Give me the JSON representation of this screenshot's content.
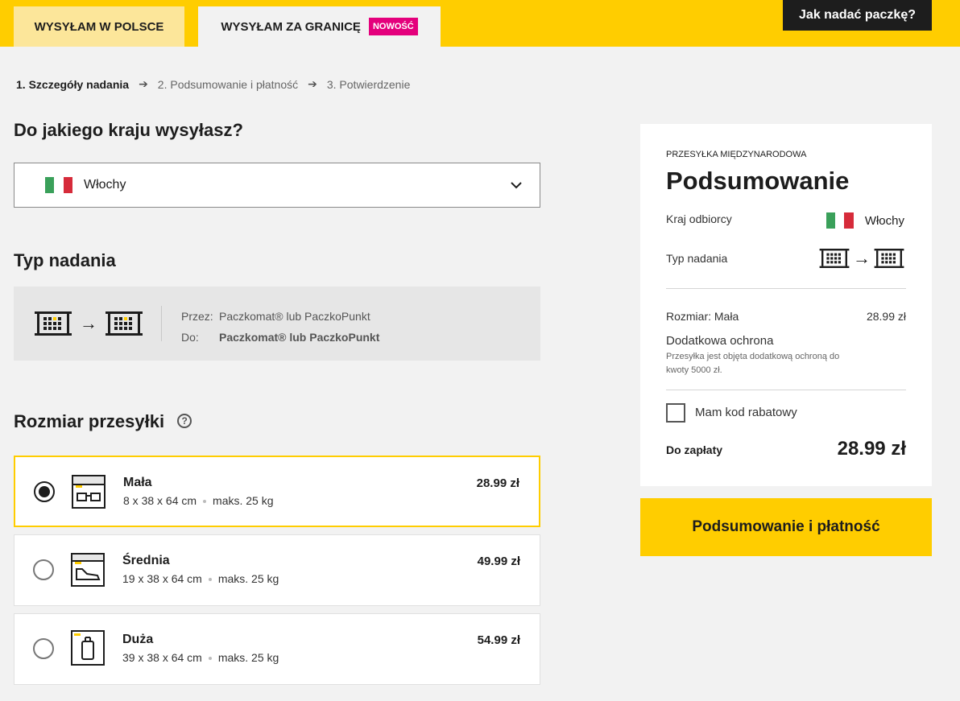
{
  "header": {
    "tab_domestic": "WYSYŁAM W POLSCE",
    "tab_abroad": "WYSYŁAM ZA GRANICĘ",
    "badge_new": "NOWOŚĆ",
    "how_to_button": "Jak nadać paczkę?",
    "accent_color": "#ffcd00"
  },
  "steps": [
    {
      "label": "1. Szczegóły nadania",
      "active": true
    },
    {
      "label": "2. Podsumowanie i płatność",
      "active": false
    },
    {
      "label": "3. Potwierdzenie",
      "active": false
    }
  ],
  "country_section": {
    "heading": "Do jakiego kraju wysyłasz?",
    "selected_country": "Włochy",
    "flag_icon": "italy-flag-icon"
  },
  "type_section": {
    "heading": "Typ nadania",
    "from_label": "Przez:",
    "from_value": "Paczkomat® lub PaczkoPunkt",
    "to_label": "Do:",
    "to_value": "Paczkomat® lub PaczkoPunkt"
  },
  "size_section": {
    "heading": "Rozmiar przesyłki",
    "help_glyph": "?",
    "options": [
      {
        "name": "Mała",
        "dims": "8 x 38 x 64 cm",
        "weight": "maks. 25 kg",
        "price": "28.99 zł",
        "selected": true,
        "icon": "glasses-box-icon"
      },
      {
        "name": "Średnia",
        "dims": "19 x 38 x 64 cm",
        "weight": "maks. 25 kg",
        "price": "49.99 zł",
        "selected": false,
        "icon": "shoe-box-icon"
      },
      {
        "name": "Duża",
        "dims": "39 x 38 x 64 cm",
        "weight": "maks. 25 kg",
        "price": "54.99 zł",
        "selected": false,
        "icon": "suitcase-box-icon"
      }
    ]
  },
  "summary": {
    "kicker": "PRZESYŁKA MIĘDZYNARODOWA",
    "title": "Podsumowanie",
    "country_label": "Kraj odbiorcy",
    "country_value": "Włochy",
    "type_label": "Typ nadania",
    "size_label": "Rozmiar: Mała",
    "size_price": "28.99 zł",
    "extra_title": "Dodatkowa ochrona",
    "extra_desc": "Przesyłka jest objęta dodatkową ochroną do kwoty 5000 zł.",
    "discount_label": "Mam kod rabatowy",
    "to_pay_label": "Do zapłaty",
    "to_pay_value": "28.99 zł"
  },
  "pay_button": "Podsumowanie i płatność"
}
